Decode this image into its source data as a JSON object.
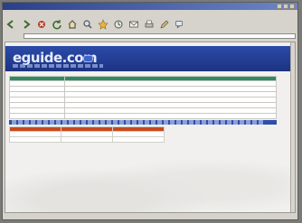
{
  "window": {
    "title": ""
  },
  "menubar": {
    "items": [
      "",
      "",
      "",
      "",
      "",
      ""
    ]
  },
  "toolbar": {
    "buttons": [
      "back-icon",
      "forward-icon",
      "stop-icon",
      "refresh-icon",
      "home-icon",
      "search-icon",
      "favorites-icon",
      "history-icon",
      "mail-icon",
      "print-icon",
      "edit-icon",
      "discuss-icon"
    ]
  },
  "address": {
    "label": "",
    "url": ""
  },
  "page": {
    "logo_text": "eguide.com",
    "table1": {
      "rows": [
        {
          "key": "",
          "value": ""
        },
        {
          "key": "",
          "value": ""
        },
        {
          "key": "",
          "value": ""
        },
        {
          "key": "",
          "value": ""
        },
        {
          "key": "",
          "value": ""
        },
        {
          "key": "",
          "value": ""
        },
        {
          "key": "",
          "value": ""
        }
      ]
    },
    "section_title": "",
    "table2": {
      "rows": [
        {
          "c1": "",
          "c2": "",
          "c3": ""
        },
        {
          "c1": "",
          "c2": "",
          "c3": ""
        }
      ]
    }
  },
  "statusbar": {
    "left": "",
    "right": ""
  },
  "colors": {
    "banner": "#203a8e",
    "table1_header": "#2f8a63",
    "table2_header": "#c8491c",
    "section_bar": "#2f4fa8"
  }
}
